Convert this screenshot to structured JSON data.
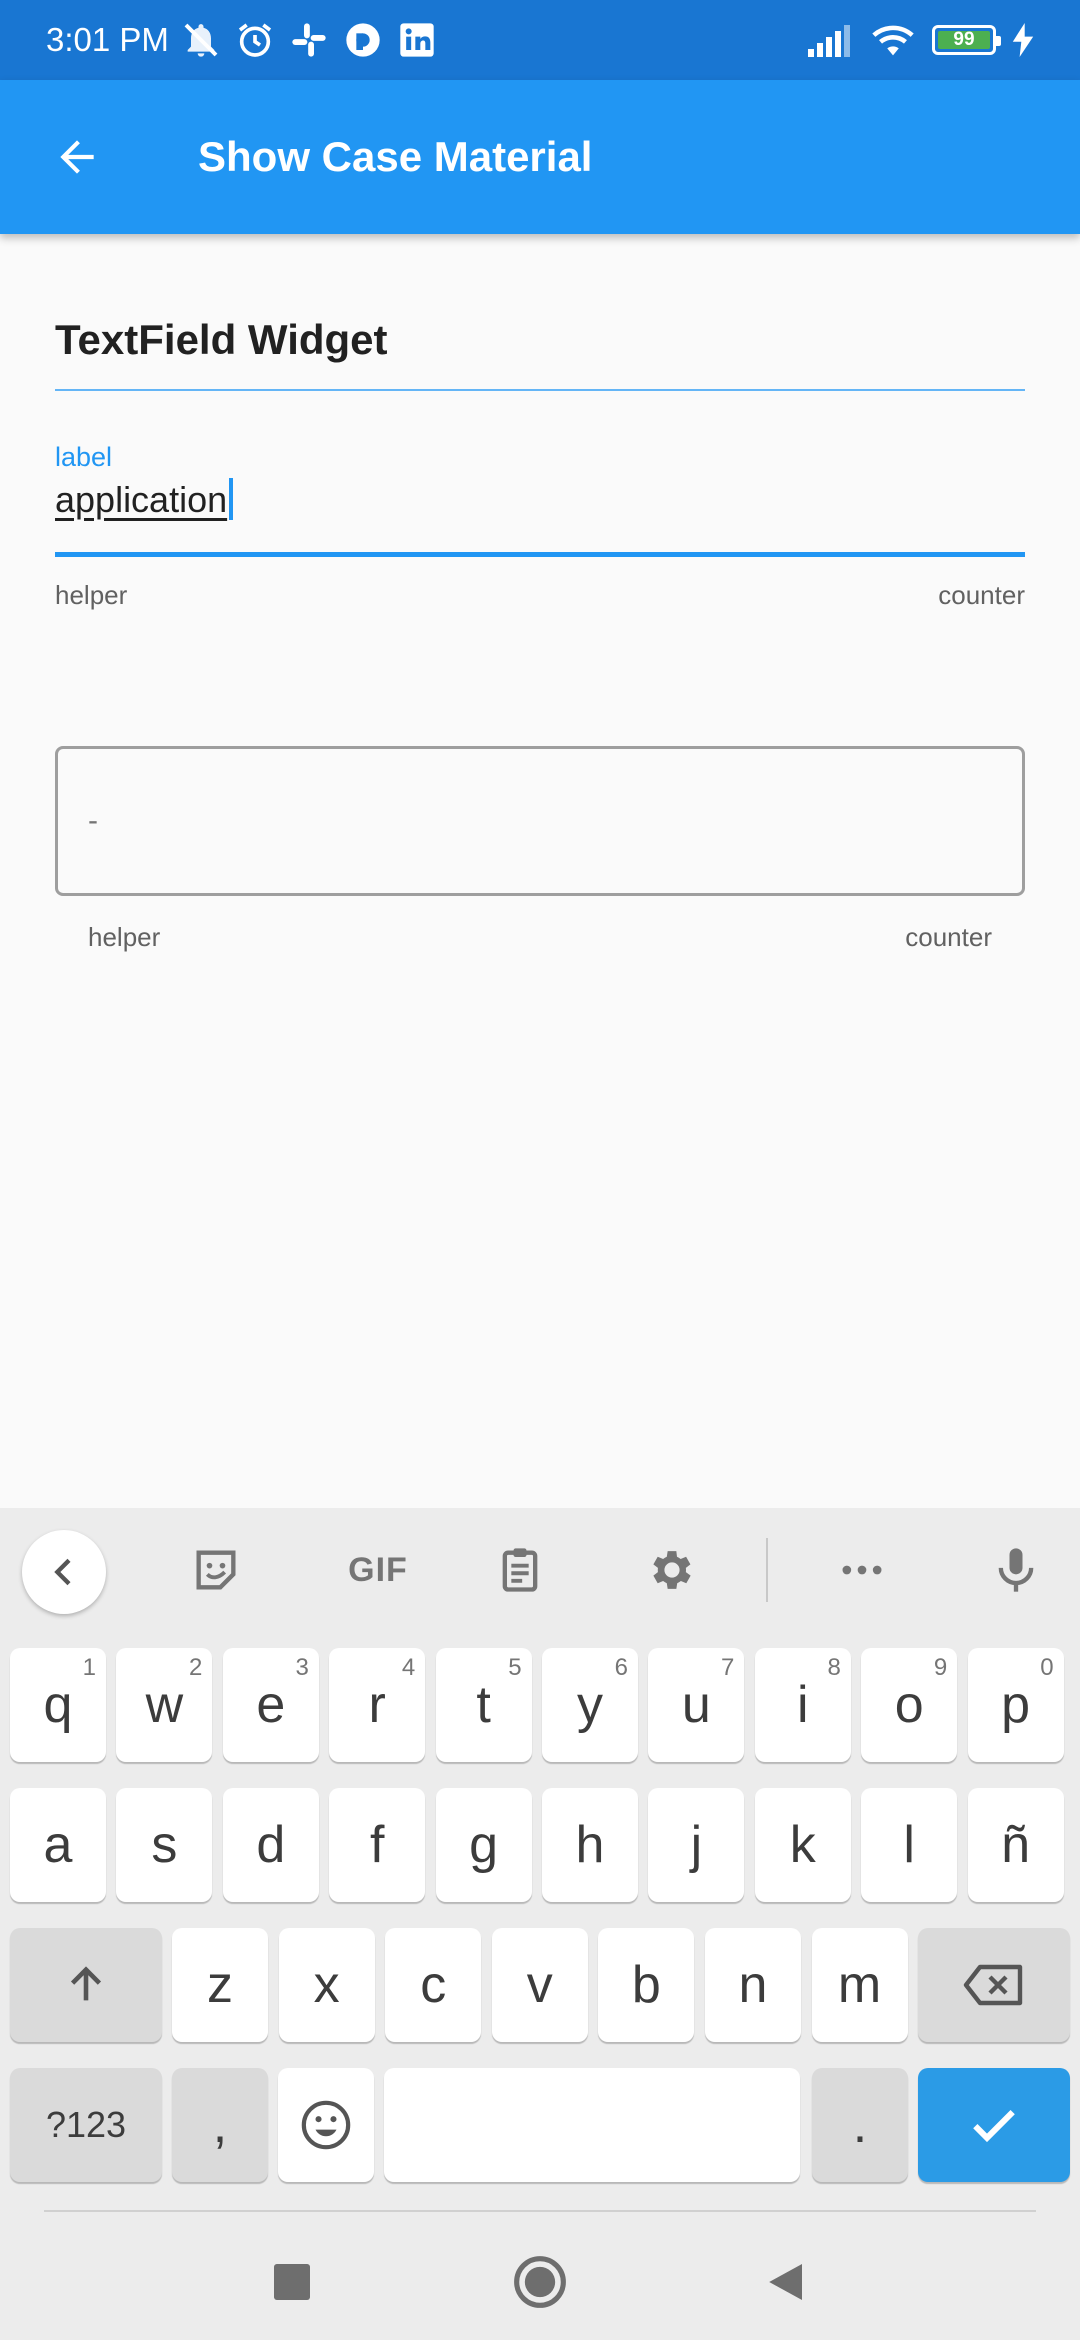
{
  "status_bar": {
    "time": "3:01 PM",
    "battery_level": "99",
    "left_icons": [
      "mute-icon",
      "alarm-icon",
      "slack-icon",
      "pocketcasts-icon",
      "linkedin-icon"
    ],
    "right_icons": [
      "signal-icon",
      "wifi-icon",
      "battery-icon",
      "charging-icon"
    ]
  },
  "app_bar": {
    "title": "Show Case Material",
    "back_icon": "arrow-back-icon",
    "color": "#2196f3"
  },
  "section": {
    "title": "TextField Widget"
  },
  "textfield_1": {
    "label": "label",
    "value": "application",
    "helper": "helper",
    "counter": "counter",
    "accent": "#2196f3"
  },
  "textfield_2": {
    "value": "-",
    "helper": "helper",
    "counter": "counter"
  },
  "keyboard": {
    "toolbar": [
      "chevron-left-icon",
      "sticker-icon",
      "gif-icon",
      "clipboard-icon",
      "settings-icon",
      "more-icon",
      "mic-icon"
    ],
    "gif_label": "GIF",
    "row1": [
      {
        "k": "q",
        "h": "1"
      },
      {
        "k": "w",
        "h": "2"
      },
      {
        "k": "e",
        "h": "3"
      },
      {
        "k": "r",
        "h": "4"
      },
      {
        "k": "t",
        "h": "5"
      },
      {
        "k": "y",
        "h": "6"
      },
      {
        "k": "u",
        "h": "7"
      },
      {
        "k": "i",
        "h": "8"
      },
      {
        "k": "o",
        "h": "9"
      },
      {
        "k": "p",
        "h": "0"
      }
    ],
    "row2": [
      "a",
      "s",
      "d",
      "f",
      "g",
      "h",
      "j",
      "k",
      "l",
      "ñ"
    ],
    "row3": [
      "z",
      "x",
      "c",
      "v",
      "b",
      "n",
      "m"
    ],
    "symbols_label": "?123",
    "comma_label": ",",
    "period_label": ".",
    "enter_color": "#2b9be6"
  },
  "nav_bar": {
    "icons": [
      "recents-square-icon",
      "home-circle-icon",
      "back-triangle-icon"
    ]
  }
}
